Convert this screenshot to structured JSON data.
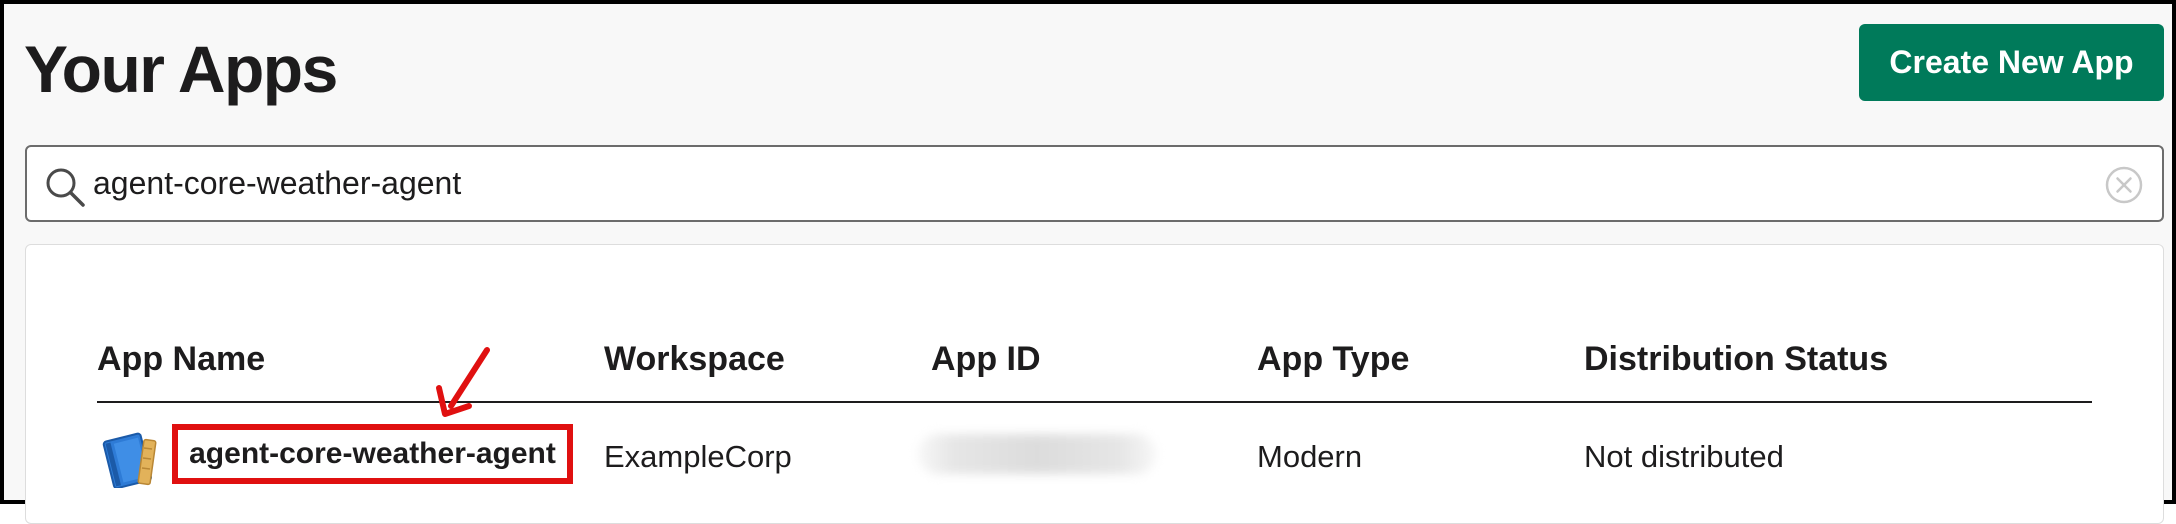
{
  "page": {
    "title": "Your Apps"
  },
  "header": {
    "create_button_label": "Create New App"
  },
  "search": {
    "value": "agent-core-weather-agent"
  },
  "table": {
    "columns": [
      "App Name",
      "Workspace",
      "App ID",
      "App Type",
      "Distribution Status"
    ],
    "rows": [
      {
        "app_name": "agent-core-weather-agent",
        "workspace": "ExampleCorp",
        "app_type": "Modern",
        "distribution_status": "Not distributed"
      }
    ]
  },
  "colors": {
    "brand_green": "#007a5a",
    "highlight_red": "#e01010"
  },
  "icons": [
    "search-icon",
    "clear-search-icon",
    "app-icon",
    "annotation-arrow"
  ]
}
